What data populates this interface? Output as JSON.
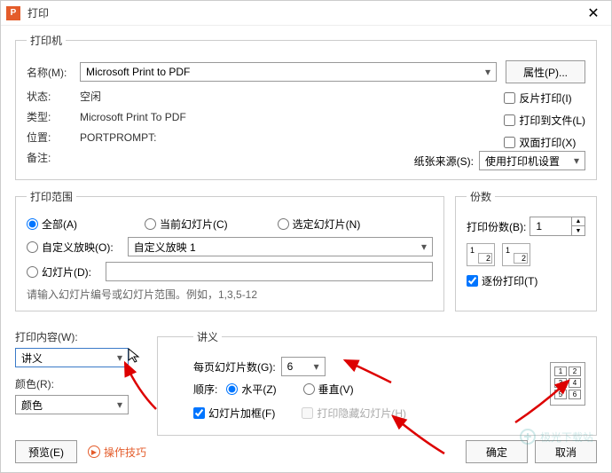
{
  "title": "打印",
  "printer": {
    "legend": "打印机",
    "name_label": "名称(M):",
    "name_value": "Microsoft Print to PDF",
    "properties_btn": "属性(P)...",
    "status_label": "状态:",
    "status_value": "空闲",
    "type_label": "类型:",
    "type_value": "Microsoft Print To PDF",
    "location_label": "位置:",
    "location_value": "PORTPROMPT:",
    "comment_label": "备注:",
    "reverse_print": "反片打印(I)",
    "print_to_file": "打印到文件(L)",
    "duplex": "双面打印(X)",
    "paper_source_label": "纸张来源(S):",
    "paper_source_value": "使用打印机设置"
  },
  "range": {
    "legend": "打印范围",
    "all": "全部(A)",
    "current": "当前幻灯片(C)",
    "selected": "选定幻灯片(N)",
    "custom_show": "自定义放映(O):",
    "custom_show_value": "自定义放映 1",
    "slides": "幻灯片(D):",
    "slides_value": "",
    "hint": "请输入幻灯片编号或幻灯片范围。例如，1,3,5-12"
  },
  "copies": {
    "legend": "份数",
    "count_label": "打印份数(B):",
    "count_value": "1",
    "collate": "逐份打印(T)"
  },
  "content": {
    "label": "打印内容(W):",
    "value": "讲义"
  },
  "color": {
    "label": "颜色(R):",
    "value": "颜色"
  },
  "handout": {
    "legend": "讲义",
    "per_page_label": "每页幻灯片数(G):",
    "per_page_value": "6",
    "order_label": "顺序:",
    "horizontal": "水平(Z)",
    "vertical": "垂直(V)",
    "frame": "幻灯片加框(F)",
    "hidden": "打印隐藏幻灯片(H)",
    "cells": [
      "1",
      "2",
      "3",
      "4",
      "5",
      "6"
    ]
  },
  "footer": {
    "preview": "预览(E)",
    "tips": "操作技巧",
    "ok": "确定",
    "cancel": "取消"
  },
  "watermark": "极光下载站"
}
